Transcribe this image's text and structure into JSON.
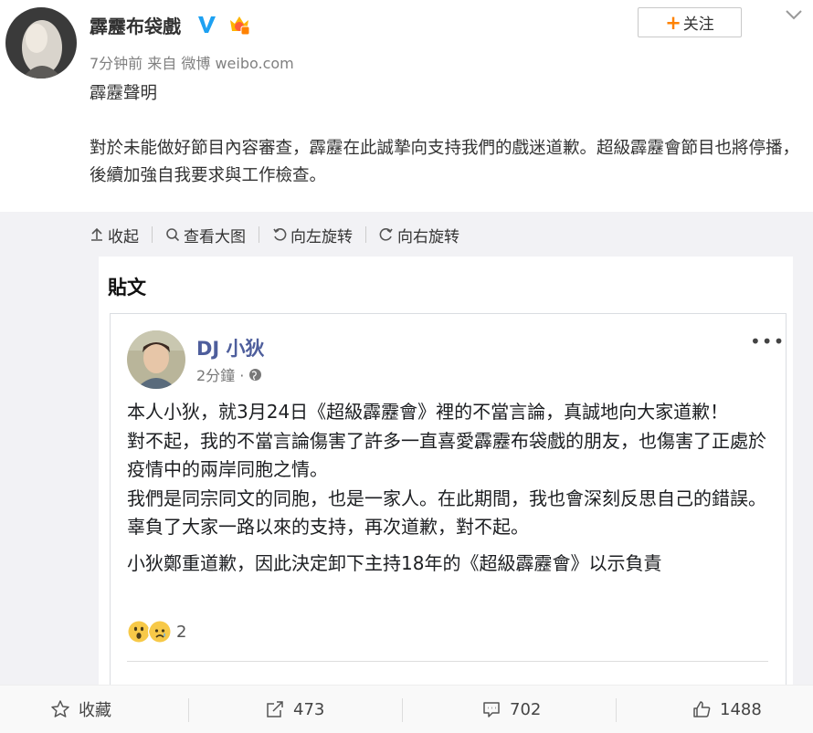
{
  "header": {
    "name": "霹靂布袋戲",
    "meta": "7分钟前 来自 微博 weibo.com",
    "follow_label": "关注",
    "follow_plus": "+"
  },
  "post": {
    "line1": "霹靂聲明",
    "line2": "對於未能做好節目內容審查，霹靂在此誠摯向支持我們的戲迷道歉。超級霹靂會節目也將停播，後續加強自我要求與工作檢查。"
  },
  "toolbar": {
    "collapse": "收起",
    "view_large": "查看大图",
    "rotate_left": "向左旋转",
    "rotate_right": "向右旋转"
  },
  "image": {
    "title": "貼文",
    "fb": {
      "name": "DJ 小狄",
      "time": "2分鐘 ·",
      "dots": "•••",
      "para1": "本人小狄，就3月24日《超級霹靂會》裡的不當言論，真誠地向大家道歉！\n對不起，我的不當言論傷害了許多一直喜愛霹靂布袋戲的朋友，也傷害了正處於疫情中的兩岸同胞之情。\n我們是同宗同文的同胞，也是一家人。在此期間，我也會深刻反思自己的錯誤。辜負了大家一路以來的支持，再次道歉，對不起。",
      "para2": "小狄鄭重道歉，因此決定卸下主持18年的《超級霹靂會》以示負責",
      "reaction_count": "2"
    }
  },
  "actions": {
    "favorite": "收藏",
    "repost": "473",
    "comment": "702",
    "like": "1488"
  },
  "colors": {
    "accent": "#ff8200",
    "fb_name": "#4e5e9c",
    "verified": "#1da1f2"
  }
}
